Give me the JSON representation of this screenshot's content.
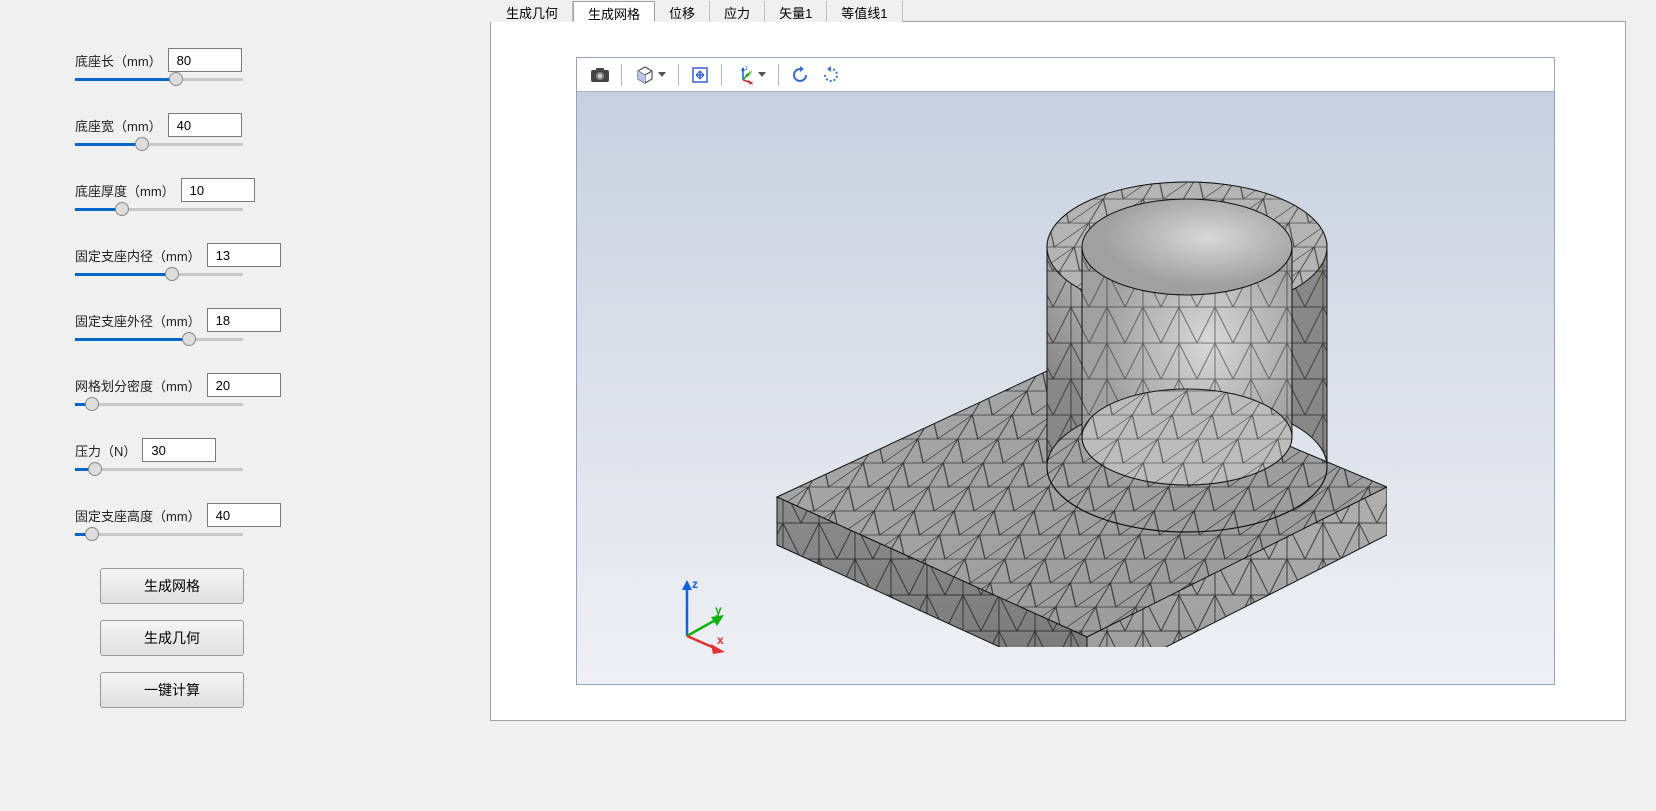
{
  "params": [
    {
      "label": "底座长（mm）",
      "value": "80",
      "fill": 60
    },
    {
      "label": "底座宽（mm）",
      "value": "40",
      "fill": 40
    },
    {
      "label": "底座厚度（mm）",
      "value": "10",
      "fill": 28
    },
    {
      "label": "固定支座内径（mm）",
      "value": "13",
      "fill": 58
    },
    {
      "label": "固定支座外径（mm）",
      "value": "18",
      "fill": 68
    },
    {
      "label": "网格划分密度（mm）",
      "value": "20",
      "fill": 10
    },
    {
      "label": "压力（N）",
      "value": "30",
      "fill": 12
    },
    {
      "label": "固定支座高度（mm）",
      "value": "40",
      "fill": 10
    }
  ],
  "buttons": {
    "generate_mesh": "生成网格",
    "generate_geometry": "生成几何",
    "one_click_compute": "一键计算"
  },
  "tabs": [
    {
      "label": "生成几何",
      "active": false
    },
    {
      "label": "生成网格",
      "active": true
    },
    {
      "label": "位移",
      "active": false
    },
    {
      "label": "应力",
      "active": false
    },
    {
      "label": "矢量1",
      "active": false
    },
    {
      "label": "等值线1",
      "active": false
    }
  ],
  "toolbar_icons": {
    "camera": "camera-icon",
    "view_cube": "view-cube-icon",
    "fit": "fit-view-icon",
    "coords": "coord-system-icon",
    "rotate_ccw": "rotate-ccw-icon",
    "rotate_cw": "rotate-cw-icon"
  },
  "axis": {
    "x": "x",
    "y": "y",
    "z": "z"
  }
}
